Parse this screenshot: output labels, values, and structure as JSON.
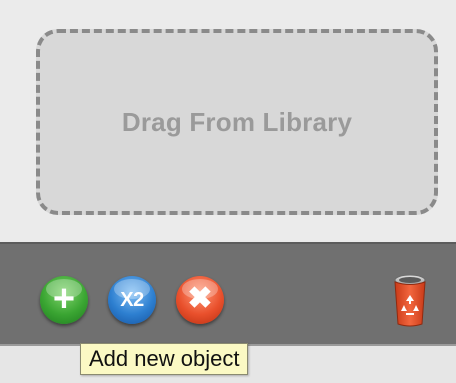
{
  "dropzone": {
    "label": "Drag From Library"
  },
  "toolbar": {
    "add_button": {
      "icon": "plus-icon",
      "glyph": "+",
      "color": "#3aa532"
    },
    "duplicate_button": {
      "icon": "x2-icon",
      "glyph": "X2",
      "color": "#2d7fd0"
    },
    "delete_button": {
      "icon": "close-icon",
      "glyph": "✖",
      "color": "#e9502c"
    },
    "trash_button": {
      "icon": "recycle-bin-icon",
      "color": "#e9502c"
    }
  },
  "tooltip": {
    "text": "Add new object"
  }
}
